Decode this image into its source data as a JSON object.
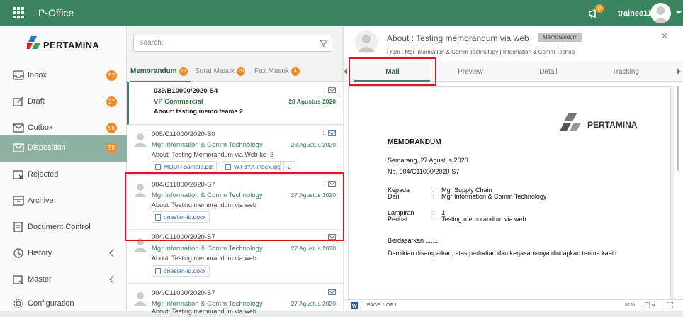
{
  "topbar": {
    "title": "P-Office",
    "notif_count": "0",
    "username": "trainee11"
  },
  "sidebar": {
    "logo_text": "PERTAMINA",
    "items": [
      {
        "label": "Inbox",
        "badge": "52",
        "icon": "inbox-icon"
      },
      {
        "label": "Draft",
        "badge": "37",
        "icon": "draft-icon"
      },
      {
        "label": "Outbox",
        "badge": "56",
        "icon": "outbox-icon"
      },
      {
        "label": "Disposition",
        "badge": "59",
        "icon": "disposition-icon"
      },
      {
        "label": "Rejected",
        "badge": "",
        "icon": "rejected-icon"
      },
      {
        "label": "Archive",
        "badge": "",
        "icon": "archive-icon"
      },
      {
        "label": "Document Control",
        "badge": "",
        "icon": "document-control-icon"
      },
      {
        "label": "History",
        "badge": "",
        "icon": "history-icon"
      },
      {
        "label": "Master",
        "badge": "",
        "icon": "master-icon"
      },
      {
        "label": "Configuration",
        "badge": "",
        "icon": "gear-icon"
      }
    ]
  },
  "list": {
    "search_placeholder": "Search..",
    "tabs": [
      {
        "label": "Memorandum",
        "badge": "29"
      },
      {
        "label": "Surat Masuk",
        "badge": "26"
      },
      {
        "label": "Fax Masuk",
        "badge": "4"
      }
    ],
    "items": [
      {
        "number": "039/B10000/2020-S4",
        "sender": "VP Commercial",
        "date": "28 Agustus 2020",
        "about": "About: testing memo teams 2",
        "attachments": [],
        "more": ""
      },
      {
        "number": "005/C11000/2020-S0",
        "sender": "Mgr Information & Comm Technology",
        "date": "28 Agustus 2020",
        "about": "About: Testing Memorandum via Web ke- 3",
        "attachments": [
          "MQUR-sample.pdf",
          "WTBYA-index.jpg"
        ],
        "more": "+2"
      },
      {
        "number": "004/C11000/2020-S7",
        "sender": "Mgr Information & Comm Technology",
        "date": "27 Agustus 2020",
        "about": "About: Testing memorandum via web",
        "attachments": [
          "onesian-id.docx"
        ],
        "more": ""
      },
      {
        "number": "004/C11000/2020-S7",
        "sender": "Mgr Information & Comm Technology",
        "date": "27 Agustus 2020",
        "about": "About: Testing memorandum via web",
        "attachments": [
          "onesian-id.docx"
        ],
        "more": ""
      },
      {
        "number": "004/C11000/2020-S7",
        "sender": "Mgr Information & Comm Technology",
        "date": "27 Agustus 2020",
        "about": "About: Testing memorandum via web",
        "attachments": [],
        "more": ""
      }
    ]
  },
  "detail": {
    "title": "About : Testing memorandum via web",
    "tag": "Memorandum",
    "from": "From : Mgr Information & Comm Technology [ Information & Comm Techno ]",
    "tabs": [
      "Mail",
      "Preview",
      "Detail",
      "Tracking"
    ],
    "doc": {
      "logo_text": "PERTAMINA",
      "heading": "MEMORANDUM",
      "place_date": "Semarang, 27 Agustus 2020",
      "number": "No. 004/C11000/2020-S7",
      "kepada_label": "Kepada",
      "kepada_value": "Mgr Supply Chain",
      "dari_label": "Dari",
      "dari_value": "Mgr Information & Comm Technology",
      "lampiran_label": "Lampiran",
      "lampiran_value": "1",
      "perihal_label": "Perihal",
      "perihal_value": "Testing memorandum via web",
      "colon": ":",
      "body1": "Berdasarkan .......",
      "body2": "Demikian disampaikan, atas perhatian dan kerjasamanya diucapkan terima kasih."
    },
    "status": {
      "page": "PAGE 1 OF 1",
      "zoom": "81%"
    }
  },
  "colors": {
    "brand_green": "#3b8460",
    "badge_orange": "#f08a24",
    "highlight_red": "#e0141e"
  }
}
